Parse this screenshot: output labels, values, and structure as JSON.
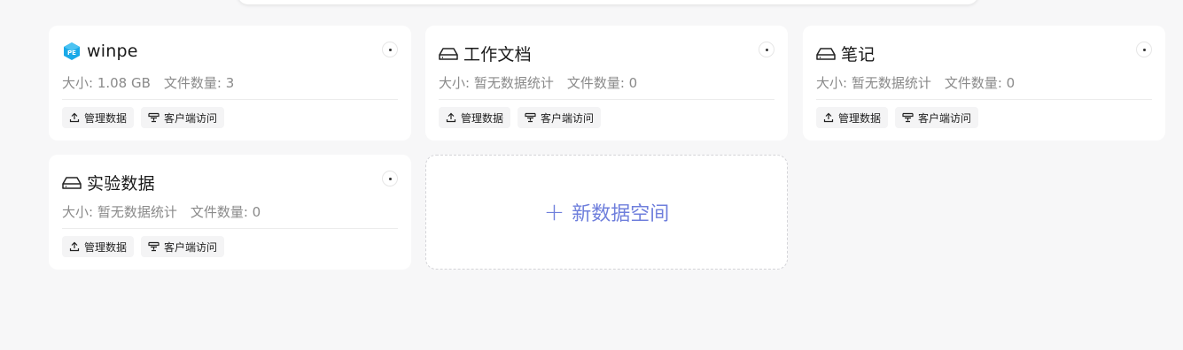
{
  "spaces": [
    {
      "title": "winpe",
      "icon": "cube-logo-icon",
      "size_label": "大小: 1.08 GB",
      "count_label": "文件数量: 3",
      "manage_label": "管理数据",
      "client_label": "客户端访问"
    },
    {
      "title": "工作文档",
      "icon": "drive-icon",
      "size_label": "大小: 暂无数据统计",
      "count_label": "文件数量: 0",
      "manage_label": "管理数据",
      "client_label": "客户端访问"
    },
    {
      "title": "笔记",
      "icon": "drive-icon",
      "size_label": "大小: 暂无数据统计",
      "count_label": "文件数量: 0",
      "manage_label": "管理数据",
      "client_label": "客户端访问"
    },
    {
      "title": "实验数据",
      "icon": "drive-icon",
      "size_label": "大小: 暂无数据统计",
      "count_label": "文件数量: 0",
      "manage_label": "管理数据",
      "client_label": "客户端访问"
    }
  ],
  "new_space": {
    "plus": "+",
    "label": "新数据空间"
  },
  "colors": {
    "accent": "#6f7fdc",
    "logo": "#1aa9e8"
  }
}
